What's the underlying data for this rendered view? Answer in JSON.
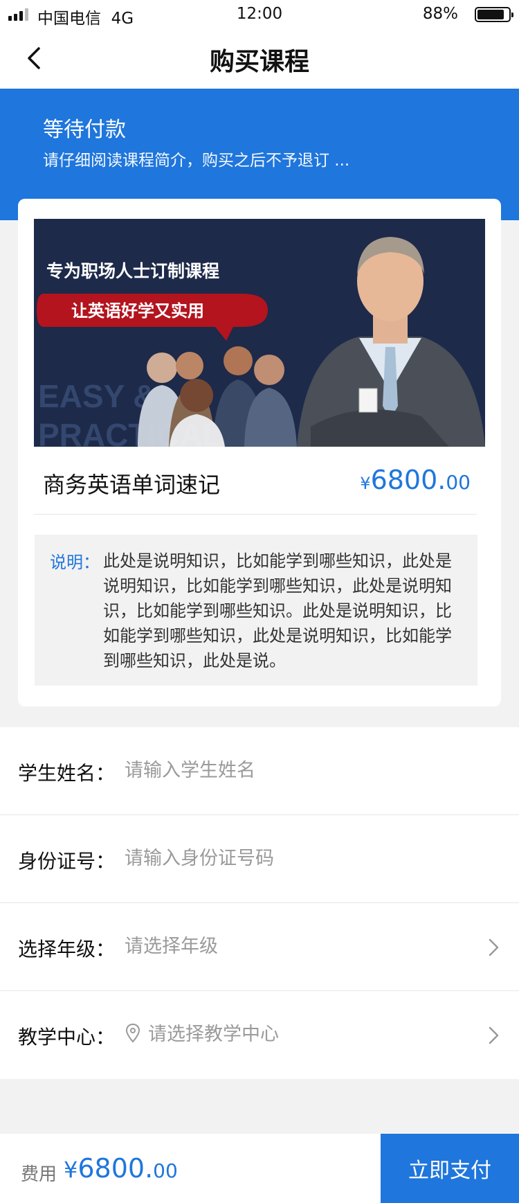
{
  "status_bar": {
    "carrier": "中国电信",
    "network": "4G",
    "time": "12:00",
    "battery": "88%"
  },
  "nav": {
    "title": "购买课程"
  },
  "banner": {
    "title": "等待付款",
    "subtitle": "请仔细阅读课程简介，购买之后不予退订 ..."
  },
  "course": {
    "image_headline": "专为职场人士订制课程",
    "image_tagline": "让英语好学又实用",
    "image_watermark_1": "EASY &",
    "image_watermark_2": "PRACTICAL",
    "name": "商务英语单词速记",
    "price_currency": "¥",
    "price_int": "6800.",
    "price_dec": "00",
    "desc_label": "说明：",
    "desc_text": "此处是说明知识，比如能学到哪些知识，此处是说明知识，比如能学到哪些知识，此处是说明知识，比如能学到哪些知识。此处是说明知识，比如能学到哪些知识，此处是说明知识，比如能学到哪些知识，此处是说。"
  },
  "form": {
    "student_name_label": "学生姓名：",
    "student_name_placeholder": "请输入学生姓名",
    "id_label": "身份证号：",
    "id_placeholder": "请输入身份证号码",
    "grade_label": "选择年级：",
    "grade_placeholder": "请选择年级",
    "center_label": "教学中心：",
    "center_placeholder": "请选择教学中心"
  },
  "footer": {
    "fee_label": "费用",
    "fee_currency": "¥",
    "fee_int": "6800.",
    "fee_dec": "00",
    "pay_label": "立即支付"
  },
  "colors": {
    "accent": "#1f76dc",
    "image_bg": "#1d2a4a",
    "ribbon": "#b3141e"
  }
}
